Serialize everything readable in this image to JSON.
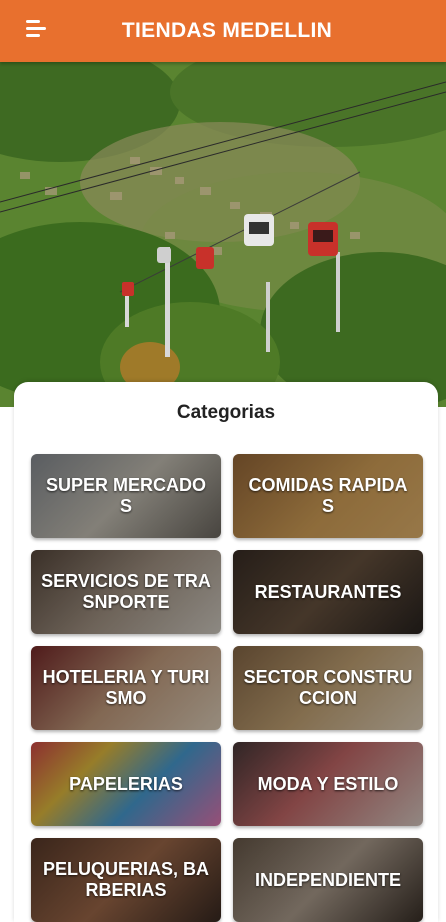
{
  "app": {
    "title": "TIENDAS MEDELLIN"
  },
  "icons": {
    "menu": "menu-icon"
  },
  "colors": {
    "primary": "#e8702e"
  },
  "section": {
    "title": "Categorias"
  },
  "categories": [
    {
      "label": "SUPER MERCADOS"
    },
    {
      "label": "COMIDAS RAPIDAS"
    },
    {
      "label": "SERVICIOS DE TRASNPORTE"
    },
    {
      "label": "RESTAURANTES"
    },
    {
      "label": "HOTELERIA Y TURISMO"
    },
    {
      "label": "SECTOR CONSTRUCCION"
    },
    {
      "label": "PAPELERIAS"
    },
    {
      "label": "MODA Y ESTILO"
    },
    {
      "label": "PELUQUERIAS, BARBERIAS"
    },
    {
      "label": "INDEPENDIENTE"
    }
  ]
}
